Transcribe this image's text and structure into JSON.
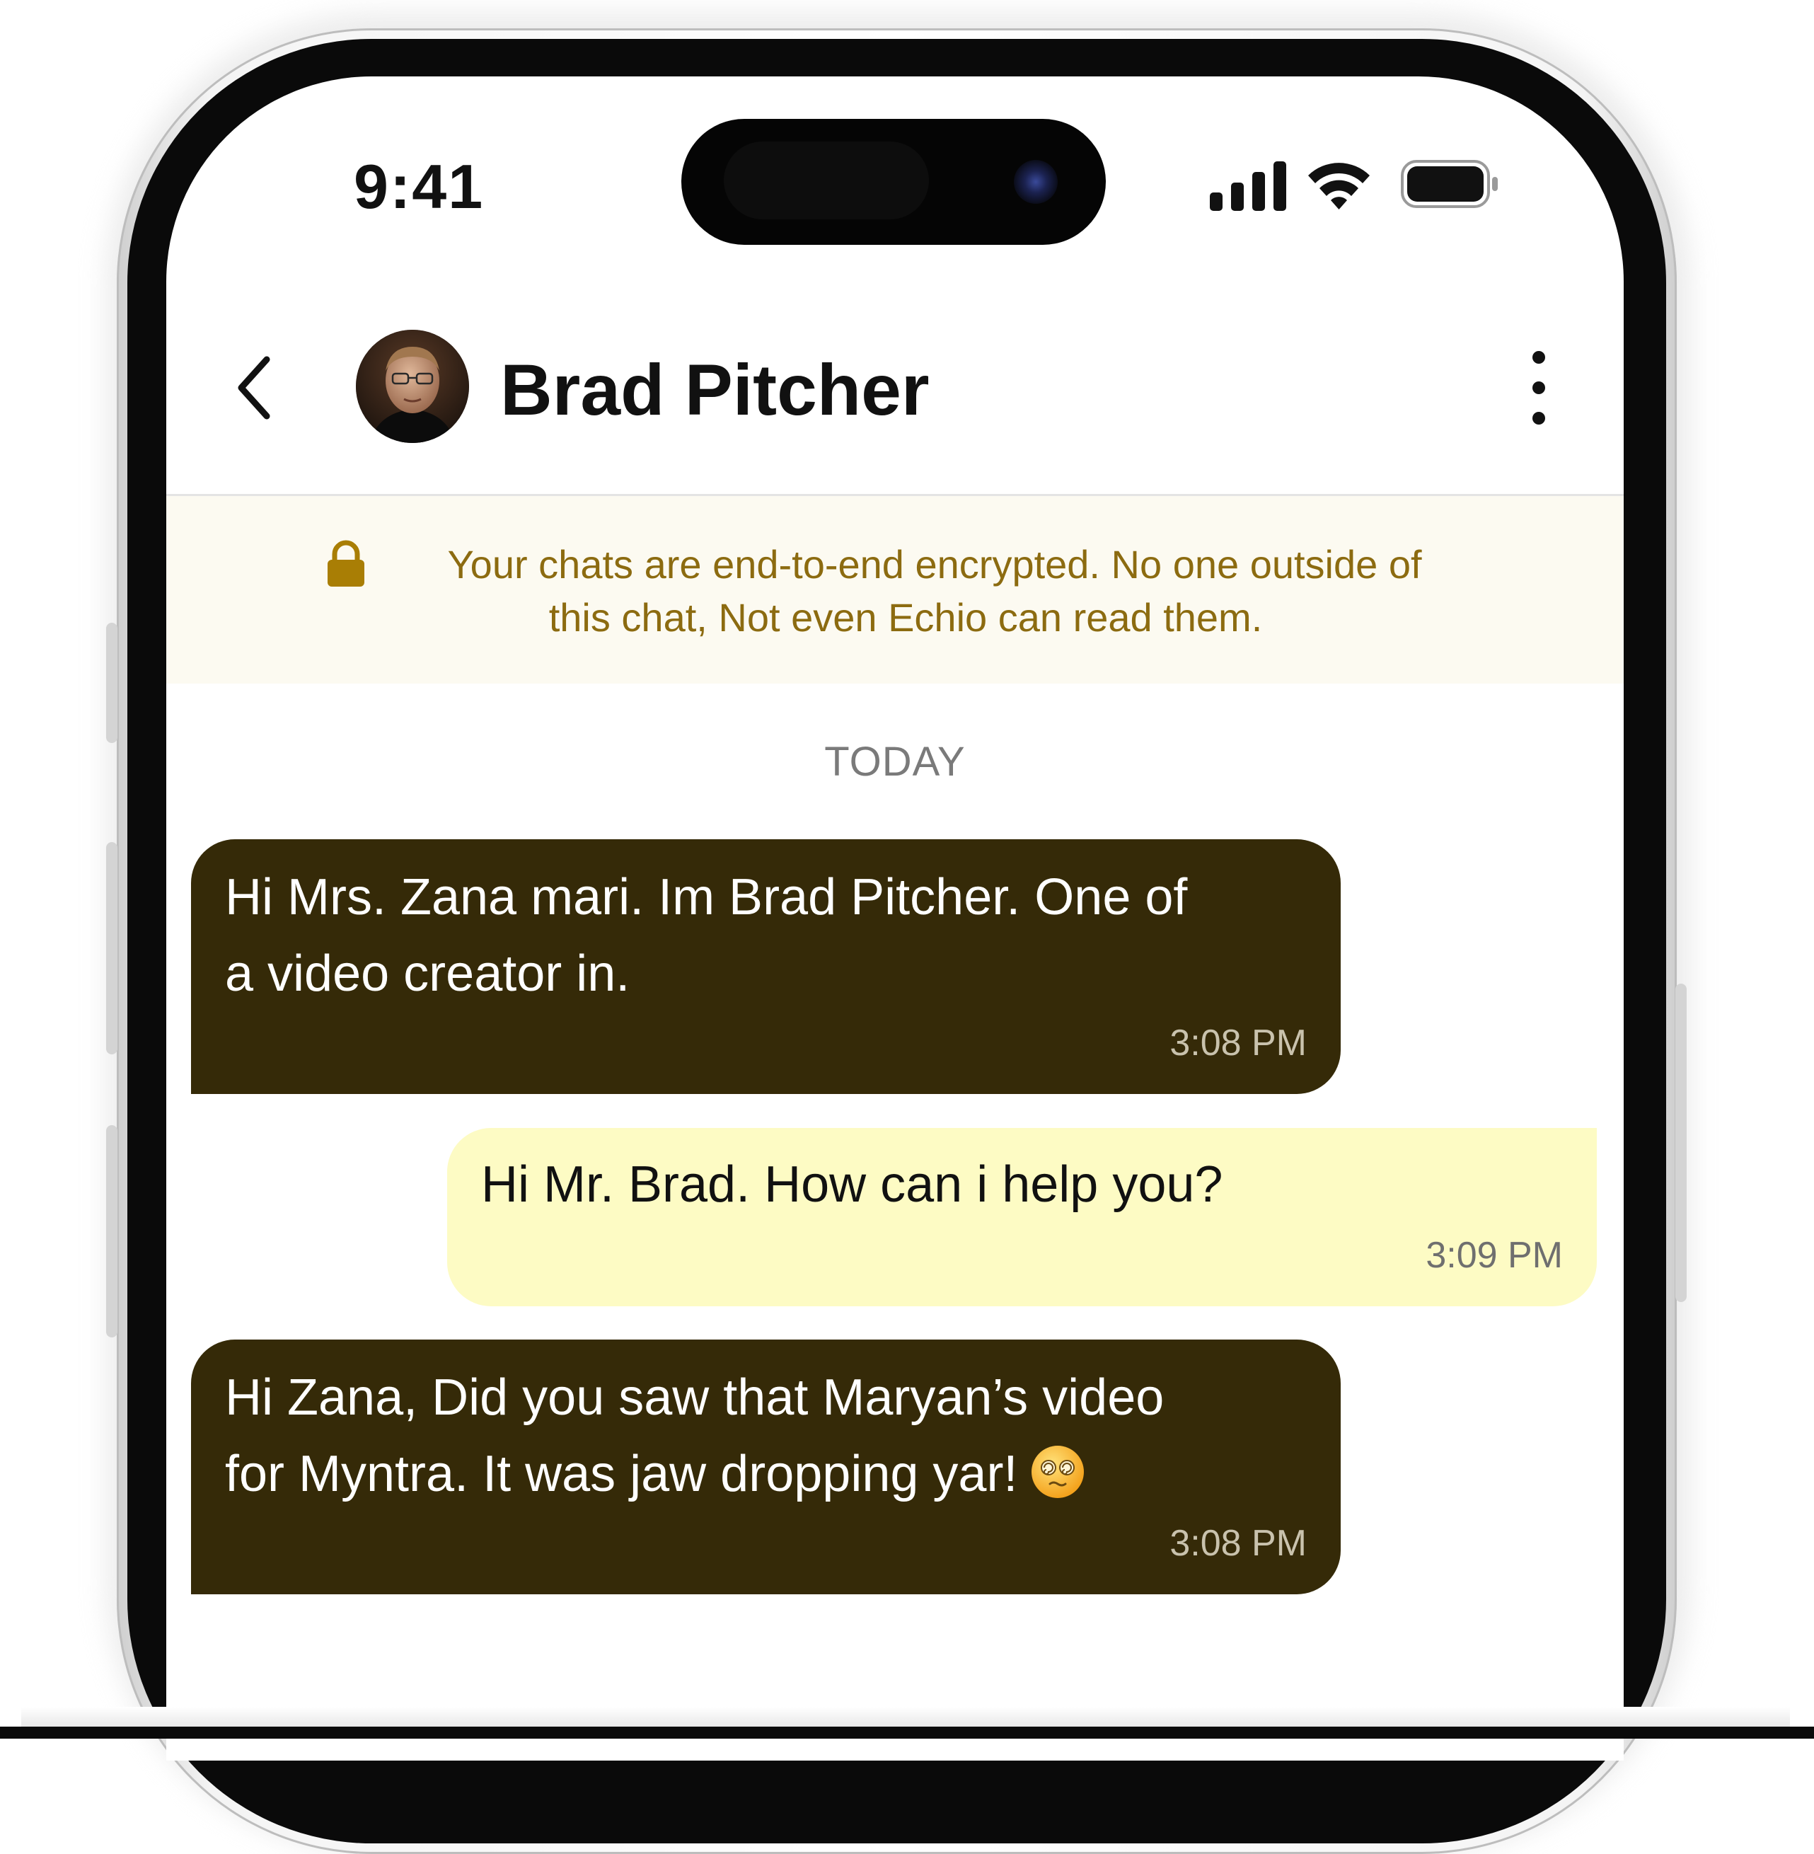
{
  "status_bar": {
    "time": "9:41",
    "icons": [
      "cellular-signal-icon",
      "wifi-icon",
      "battery-icon"
    ]
  },
  "header": {
    "back_icon": "chevron-left-icon",
    "contact_name": "Brad Pitcher",
    "more_icon": "vertical-ellipsis-icon"
  },
  "encryption_notice": {
    "icon": "lock-icon",
    "line1": "Your chats are end-to-end encrypted. No one outside of",
    "line2": "this chat, Not even Echio can read them."
  },
  "date_separator": "TODAY",
  "messages": [
    {
      "direction": "incoming",
      "lines": [
        "Hi Mrs. Zana mari. Im Brad Pitcher. One of",
        "a video creator in."
      ],
      "time": "3:08 PM"
    },
    {
      "direction": "outgoing",
      "lines": [
        "Hi Mr. Brad. How can i help you?"
      ],
      "time": "3:09 PM"
    },
    {
      "direction": "incoming",
      "lines": [
        "Hi Zana, Did you saw that Maryan’s video",
        "for Myntra. It was jaw dropping yar!"
      ],
      "emoji": "dizzy-face-emoji",
      "time": "3:08 PM"
    }
  ],
  "colors": {
    "incoming_bubble": "#352a08",
    "outgoing_bubble": "#fdfbc4",
    "banner_background": "#fcfaf1",
    "banner_text": "#8c6b10",
    "lock_icon": "#a97e05"
  }
}
